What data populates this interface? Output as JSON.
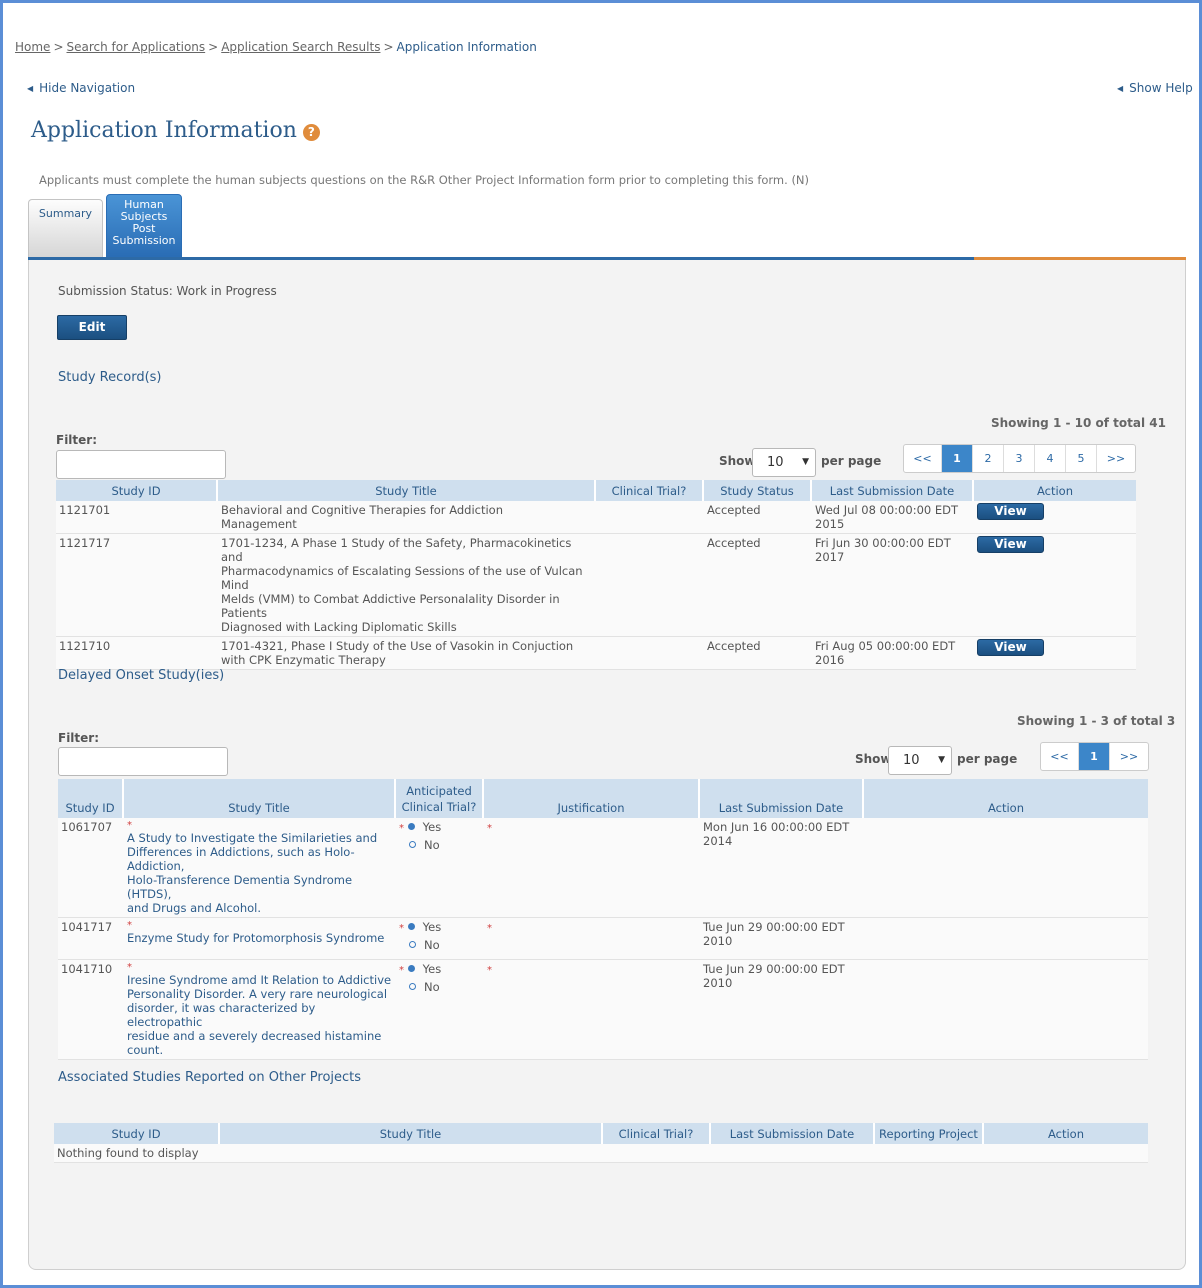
{
  "breadcrumb": {
    "home": "Home",
    "search": "Search for Applications",
    "results": "Application Search Results",
    "current": "Application Information",
    "sep": ">"
  },
  "nav": {
    "hide": "Hide Navigation",
    "show_help": "Show Help"
  },
  "title": "Application Information",
  "help_glyph": "?",
  "notice": "Applicants must complete the human subjects questions on the R&R Other Project Information form prior to completing this form. (N)",
  "tabs": {
    "summary": "Summary",
    "hs_line1": "Human",
    "hs_line2": "Subjects",
    "hs_line3": "Post",
    "hs_line4": "Submission"
  },
  "submission_status": "Submission Status: Work in Progress",
  "edit_label": "Edit",
  "study_records": {
    "title": "Study Record(s)",
    "showing": "Showing 1 - 10 of total 41",
    "filter_label": "Filter:",
    "show": "Show",
    "per_page": "per page",
    "page_size": "10",
    "pager": [
      "<<",
      "1",
      "2",
      "3",
      "4",
      "5",
      ">>"
    ],
    "columns": [
      "Study ID",
      "Study Title",
      "Clinical Trial?",
      "Study Status",
      "Last Submission Date",
      "Action"
    ],
    "view_label": "View",
    "rows": [
      {
        "id": "1121701",
        "title": [
          "Behavioral and Cognitive Therapies for Addiction",
          "Management"
        ],
        "clinical": "",
        "status": "Accepted",
        "date": [
          "Wed Jul 08 00:00:00 EDT",
          "2015"
        ]
      },
      {
        "id": "1121717",
        "title": [
          "1701-1234, A Phase 1 Study of the Safety, Pharmacokinetics and",
          "Pharmacodynamics of Escalating Sessions of the use of Vulcan Mind",
          "Melds (VMM) to Combat Addictive Personalality Disorder in Patients",
          "Diagnosed with Lacking Diplomatic Skills"
        ],
        "clinical": "",
        "status": "Accepted",
        "date": [
          "Fri Jun 30 00:00:00 EDT",
          "2017"
        ]
      },
      {
        "id": "1121710",
        "title": [
          "1701-4321, Phase I Study of the Use of Vasokin in Conjuction",
          "with CPK Enzymatic Therapy"
        ],
        "clinical": "",
        "status": "Accepted",
        "date": [
          "Fri Aug 05 00:00:00 EDT",
          "2016"
        ]
      }
    ]
  },
  "delayed": {
    "title": "Delayed Onset Study(ies)",
    "showing": "Showing 1 - 3 of total 3",
    "filter_label": "Filter:",
    "show": "Show",
    "per_page": "per page",
    "page_size": "10",
    "pager": [
      "<<",
      "1",
      ">>"
    ],
    "columns": [
      "Study ID",
      "Study Title",
      "Anticipated",
      "Clinical Trial?",
      "Justification",
      "Last Submission Date",
      "Action"
    ],
    "required_mark": "*",
    "yes": "Yes",
    "no": "No",
    "rows": [
      {
        "id": "1061707",
        "title": [
          "A Study to Investigate the Similarieties and",
          "Differences in Addictions, such as Holo-Addiction,",
          "Holo-Transference Dementia Syndrome (HTDS),",
          "and Drugs and Alcohol."
        ],
        "selected": "Yes",
        "date": [
          "Mon Jun 16 00:00:00 EDT",
          "2014"
        ]
      },
      {
        "id": "1041717",
        "title": [
          "Enzyme Study for Protomorphosis Syndrome"
        ],
        "selected": "Yes",
        "date": [
          "Tue Jun 29 00:00:00 EDT",
          "2010"
        ]
      },
      {
        "id": "1041710",
        "title": [
          "Iresine Syndrome amd It Relation to Addictive",
          "Personality Disorder. A very rare neurological",
          "disorder, it was characterized by electropathic",
          "residue and a severely decreased histamine count."
        ],
        "selected": "Yes",
        "date": [
          "Tue Jun 29 00:00:00 EDT",
          "2010"
        ]
      }
    ]
  },
  "associated": {
    "title": "Associated Studies Reported on Other Projects",
    "columns": [
      "Study ID",
      "Study Title",
      "Clinical Trial?",
      "Last Submission Date",
      "Reporting Project",
      "Action"
    ],
    "empty": "Nothing found to display"
  },
  "colors": {
    "accent": "#2d5c8a",
    "button": "#1f5a90",
    "active_tab": "#3380c8",
    "orange": "#e08c3c",
    "header_bg": "#cfdfee"
  }
}
